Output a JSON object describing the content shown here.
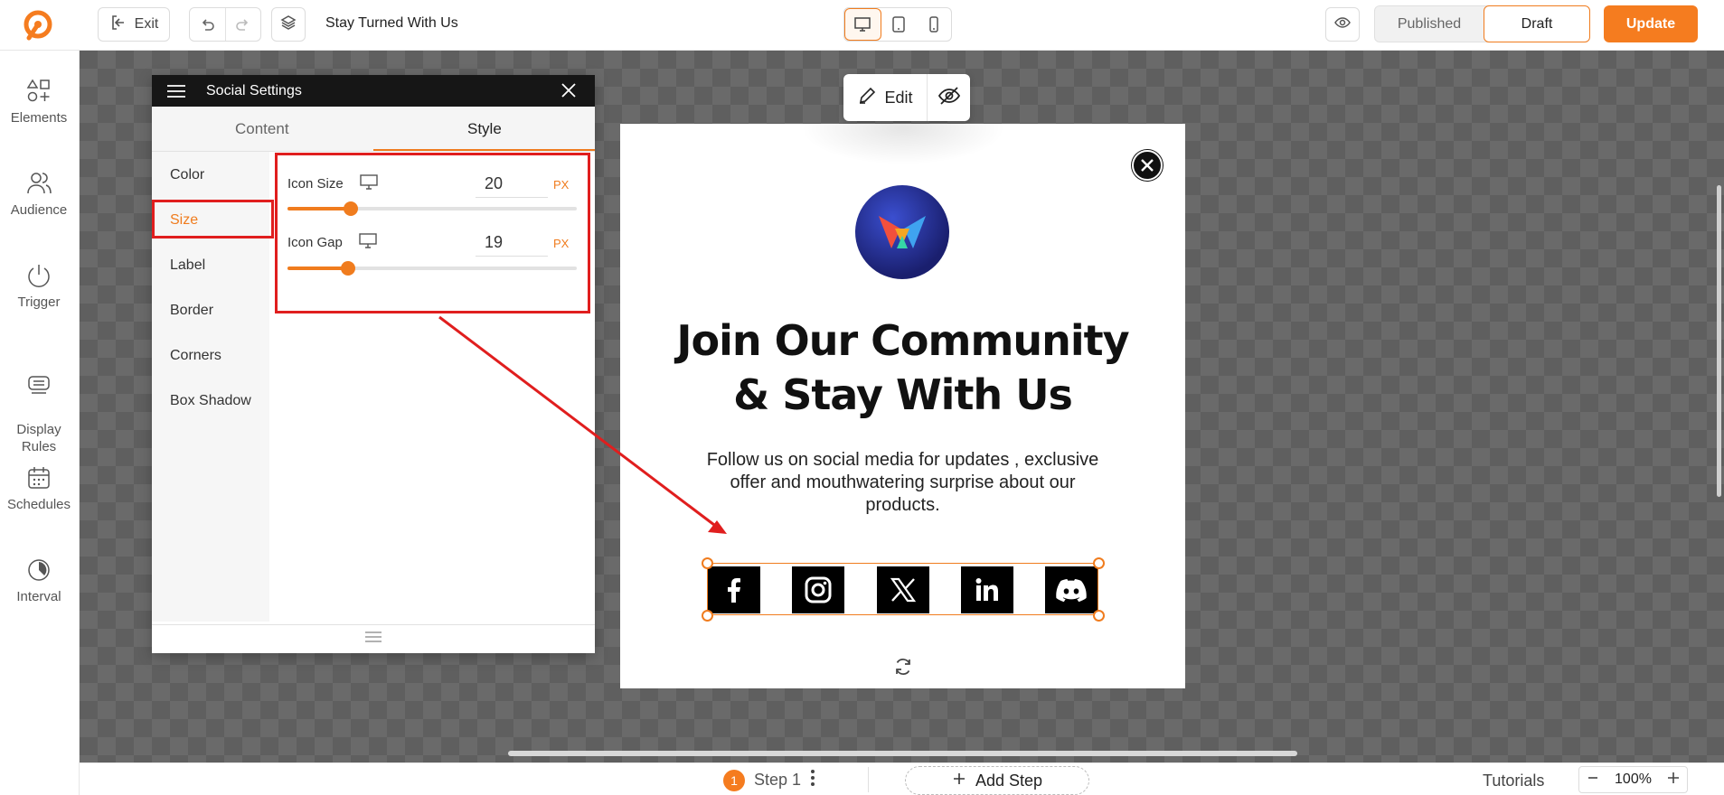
{
  "topbar": {
    "exit_label": "Exit",
    "document_title": "Stay Turned With Us",
    "status_published": "Published",
    "status_draft": "Draft",
    "update_label": "Update",
    "brand_color": "#f57c1f"
  },
  "sidebar": {
    "items": [
      {
        "label": "Elements",
        "icon": "elements-icon"
      },
      {
        "label": "Audience",
        "icon": "audience-icon"
      },
      {
        "label": "Trigger",
        "icon": "power-icon"
      },
      {
        "label": "Display\nRules",
        "icon": "display-rules-icon"
      },
      {
        "label": "Schedules",
        "icon": "calendar-icon"
      },
      {
        "label": "Interval",
        "icon": "interval-icon"
      }
    ]
  },
  "panel": {
    "title": "Social Settings",
    "tabs": [
      "Content",
      "Style"
    ],
    "active_tab": "Style",
    "menu": [
      "Color",
      "Size",
      "Label",
      "Border",
      "Corners",
      "Box Shadow"
    ],
    "active_menu": "Size",
    "icon_size": {
      "label": "Icon Size",
      "value": "20",
      "unit": "PX",
      "fraction": 0.22
    },
    "icon_gap": {
      "label": "Icon Gap",
      "value": "19",
      "unit": "PX",
      "fraction": 0.21
    }
  },
  "edit_bar": {
    "edit_label": "Edit"
  },
  "popup": {
    "heading_line1": "Join Our Community",
    "heading_line2": "& Stay With Us",
    "subtext": "Follow us on social media for updates , exclusive offer and mouthwatering surprise about our products.",
    "social_icons": [
      "facebook-icon",
      "instagram-icon",
      "x-icon",
      "linkedin-icon",
      "discord-icon"
    ]
  },
  "bottombar": {
    "step_number": "1",
    "step_label": "Step 1",
    "add_step_label": "Add Step",
    "tutorials_label": "Tutorials",
    "zoom_level": "100%"
  }
}
